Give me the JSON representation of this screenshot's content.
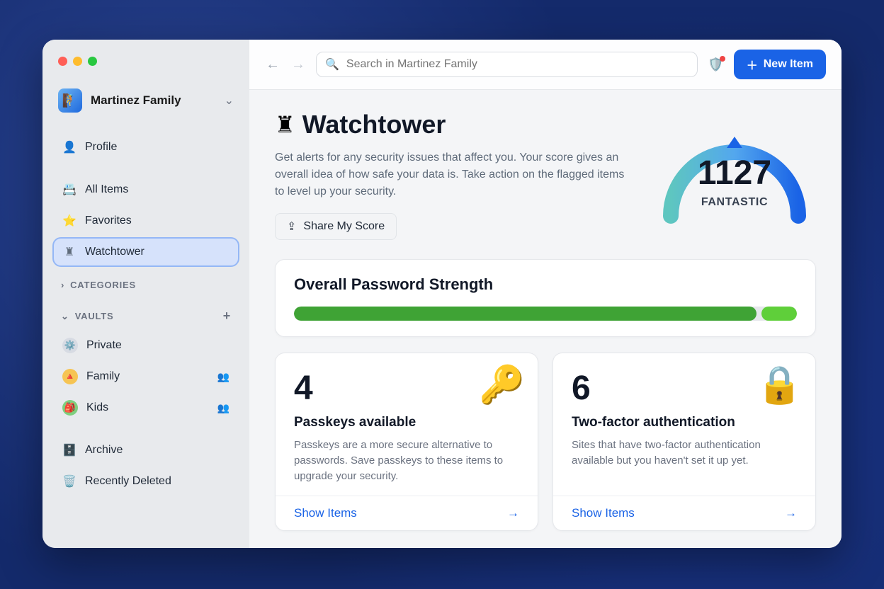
{
  "account": {
    "name": "Martinez Family"
  },
  "sidebar": {
    "profile": "Profile",
    "items": [
      {
        "label": "All Items",
        "icon": "📇"
      },
      {
        "label": "Favorites",
        "icon": "⭐"
      },
      {
        "label": "Watchtower",
        "icon": "♜"
      }
    ],
    "categories_header": "CATEGORIES",
    "vaults_header": "VAULTS",
    "vaults": [
      {
        "label": "Private",
        "icon": "⚙️",
        "shared": false
      },
      {
        "label": "Family",
        "icon": "🔺",
        "shared": true
      },
      {
        "label": "Kids",
        "icon": "🎒",
        "shared": true
      }
    ],
    "archive": "Archive",
    "recently_deleted": "Recently Deleted"
  },
  "topbar": {
    "search_placeholder": "Search in Martinez Family",
    "new_item": "New Item"
  },
  "watchtower": {
    "title": "Watchtower",
    "description": "Get alerts for any security issues that affect you. Your score gives an overall idea of how safe your data is. Take action on the flagged items to level up your security.",
    "share_label": "Share My Score",
    "score": "1127",
    "rating": "FANTASTIC",
    "strength_title": "Overall Password Strength",
    "cards": [
      {
        "count": "4",
        "title": "Passkeys available",
        "desc": "Passkeys are a more secure alternative to passwords. Save passkeys to these items to upgrade your security.",
        "cta": "Show Items"
      },
      {
        "count": "6",
        "title": "Two-factor authentication",
        "desc": "Sites that have two-factor authentication available but you haven't set it up yet.",
        "cta": "Show Items"
      }
    ]
  }
}
